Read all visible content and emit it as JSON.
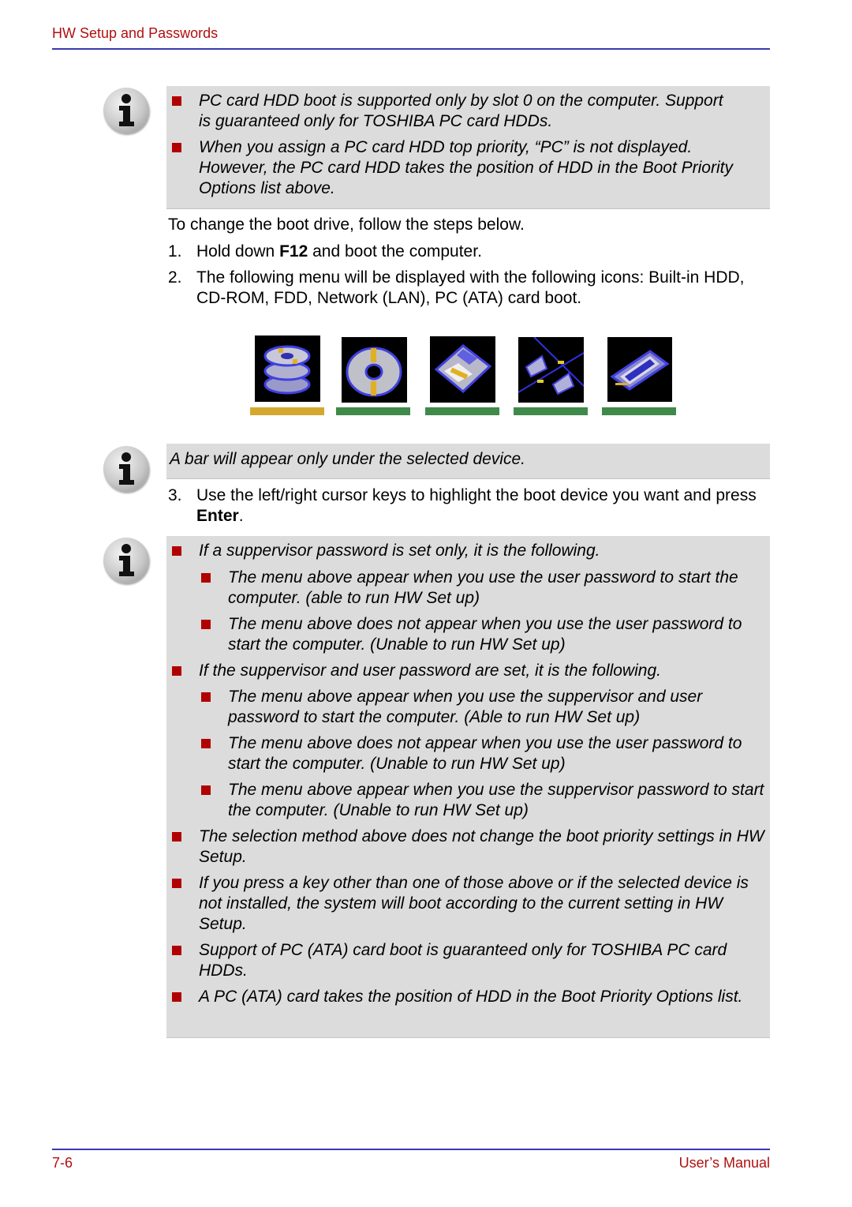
{
  "header": {
    "title": "HW Setup and Passwords"
  },
  "note1": {
    "bullets": [
      "PC card HDD boot is supported only by slot 0 on the computer. Support is guaranteed only for TOSHIBA PC card HDDs.",
      "When you assign a PC card HDD top priority, “PC” is not displayed. However, the PC card HDD takes the position of HDD in the Boot Priority Options list above."
    ]
  },
  "intro": "To change the boot drive, follow the steps below.",
  "steps": [
    {
      "num": "1.",
      "pre": "Hold down ",
      "bold": "F12",
      "post": " and boot the computer."
    },
    {
      "num": "2.",
      "text": "The following menu will be displayed with the following icons: Built-in HDD, CD-ROM, FDD, Network (LAN), PC (ATA) card boot."
    },
    {
      "num": "3.",
      "pre": "Use the left/right cursor keys to highlight the boot device you want and press ",
      "bold": "Enter",
      "post": "."
    }
  ],
  "boot_menu": {
    "devices": [
      {
        "name": "Built-in HDD",
        "icon": "hdd-stack-icon",
        "selected": true
      },
      {
        "name": "CD-ROM",
        "icon": "cd-rom-icon",
        "selected": false
      },
      {
        "name": "FDD",
        "icon": "floppy-disk-icon",
        "selected": false
      },
      {
        "name": "Network (LAN)",
        "icon": "network-lan-icon",
        "selected": false
      },
      {
        "name": "PC (ATA) card",
        "icon": "pc-card-icon",
        "selected": false
      }
    ],
    "colors": {
      "selected": "#d4a830",
      "unselected": "#3f8a4a"
    }
  },
  "note2": {
    "text": "A bar will appear only under the selected device."
  },
  "note3": {
    "items": [
      {
        "level": 1,
        "text": "If a suppervisor password is set only, it is the following."
      },
      {
        "level": 2,
        "text": "The menu above appear when you use the user password to start the computer. (able to run HW Set up)"
      },
      {
        "level": 2,
        "text": "The menu above does not appear when you use the user password to start the computer. (Unable to run HW Set up)"
      },
      {
        "level": 1,
        "text": "If the suppervisor and user password are set, it is the following."
      },
      {
        "level": 2,
        "text": "The menu above appear when you use the suppervisor and user password to start the computer. (Able to run HW Set up)"
      },
      {
        "level": 2,
        "text": "The menu above does not appear when you use the user password to start the computer. (Unable to run HW Set up)"
      },
      {
        "level": 2,
        "text": "The menu above appear when you use the suppervisor password to start the computer. (Unable to run HW Set up)"
      },
      {
        "level": 1,
        "text": "The selection method above does not change the boot priority settings in HW Setup."
      },
      {
        "level": 1,
        "text": "If you press a key other than one of those above or if the selected device is not installed, the system will boot according to the current setting in HW Setup."
      },
      {
        "level": 1,
        "text": "Support of PC (ATA) card boot is guaranteed only for TOSHIBA PC card HDDs."
      },
      {
        "level": 1,
        "text": "A PC (ATA) card takes the position of HDD in the Boot Priority Options list."
      }
    ]
  },
  "footer": {
    "page": "7-6",
    "title": "User’s Manual"
  },
  "colors": {
    "accent_red": "#b01010",
    "rule_blue": "#3a3ab0",
    "note_bg": "#dcdcdc",
    "bullet": "#b00000"
  }
}
